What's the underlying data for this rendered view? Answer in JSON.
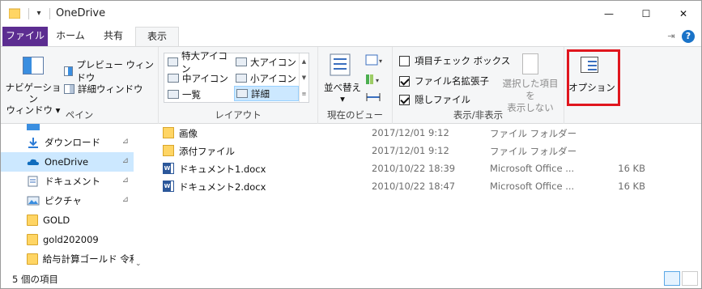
{
  "window": {
    "title": "OneDrive",
    "quick_access_glyph": "▾"
  },
  "window_controls": {
    "minimize": "—",
    "maximize": "☐",
    "close": "✕"
  },
  "tabs": [
    {
      "label": "ファイル"
    },
    {
      "label": "ホーム"
    },
    {
      "label": "共有"
    },
    {
      "label": "表示"
    }
  ],
  "tabs_right": {
    "pin_glyph": "⇥",
    "help_glyph": "?"
  },
  "ribbon": {
    "pane": {
      "group_label": "ペイン",
      "nav_pane_label_1": "ナビゲーション",
      "nav_pane_label_2": "ウィンドウ ▾",
      "preview_pane": "プレビュー ウィンドウ",
      "details_pane": "詳細ウィンドウ"
    },
    "layout": {
      "group_label": "レイアウト",
      "items": [
        "特大アイコン",
        "大アイコン",
        "中アイコン",
        "小アイコン",
        "一覧",
        "詳細"
      ],
      "selected": "詳細",
      "scroll_up": "▲",
      "scroll_down": "▼",
      "scroll_more": "≡"
    },
    "current_view": {
      "group_label": "現在のビュー",
      "sort_label": "並べ替え",
      "sort_arrow": "▾",
      "small_arrow": "▾"
    },
    "show_hide": {
      "group_label": "表示/非表示",
      "item_checkbox": {
        "label": "項目チェック ボックス",
        "checked": false
      },
      "file_extensions": {
        "label": "ファイル名拡張子",
        "checked": true
      },
      "hidden_items": {
        "label": "隠しファイル",
        "checked": true
      },
      "hide_selected_1": "選択した項目を",
      "hide_selected_2": "表示しない"
    },
    "options": {
      "label": "オプション",
      "highlight_color": "#e0161e"
    }
  },
  "nav_pane": {
    "items": [
      {
        "label": "ダウンロード",
        "icon": "download-icon",
        "pinned": true,
        "selected": false
      },
      {
        "label": "OneDrive",
        "icon": "cloud-icon",
        "pinned": true,
        "selected": true
      },
      {
        "label": "ドキュメント",
        "icon": "documents-icon",
        "pinned": true,
        "selected": false
      },
      {
        "label": "ピクチャ",
        "icon": "pictures-icon",
        "pinned": true,
        "selected": false
      },
      {
        "label": "GOLD",
        "icon": "folder-icon",
        "pinned": false,
        "selected": false
      },
      {
        "label": "gold202009",
        "icon": "folder-icon",
        "pinned": false,
        "selected": false
      },
      {
        "label": "給与計算ゴールド 令和",
        "icon": "folder-icon",
        "pinned": false,
        "selected": false
      }
    ],
    "pin_glyph": "📌",
    "scroll_down": "⌄"
  },
  "files": [
    {
      "name": "画像",
      "date": "2017/12/01 9:12",
      "type": "ファイル フォルダー",
      "size": "",
      "icon": "folder-icon"
    },
    {
      "name": "添付ファイル",
      "date": "2017/12/01 9:12",
      "type": "ファイル フォルダー",
      "size": "",
      "icon": "folder-icon"
    },
    {
      "name": "ドキュメント1.docx",
      "date": "2010/10/22 18:39",
      "type": "Microsoft Office ...",
      "size": "16 KB",
      "icon": "word-doc-icon"
    },
    {
      "name": "ドキュメント2.docx",
      "date": "2010/10/22 18:47",
      "type": "Microsoft Office ...",
      "size": "16 KB",
      "icon": "word-doc-icon"
    }
  ],
  "status": {
    "item_count": "5 個の項目"
  },
  "colors": {
    "file_tab": "#5c2d91",
    "selection": "#cce8ff",
    "accent_blue": "#1a73c8"
  }
}
